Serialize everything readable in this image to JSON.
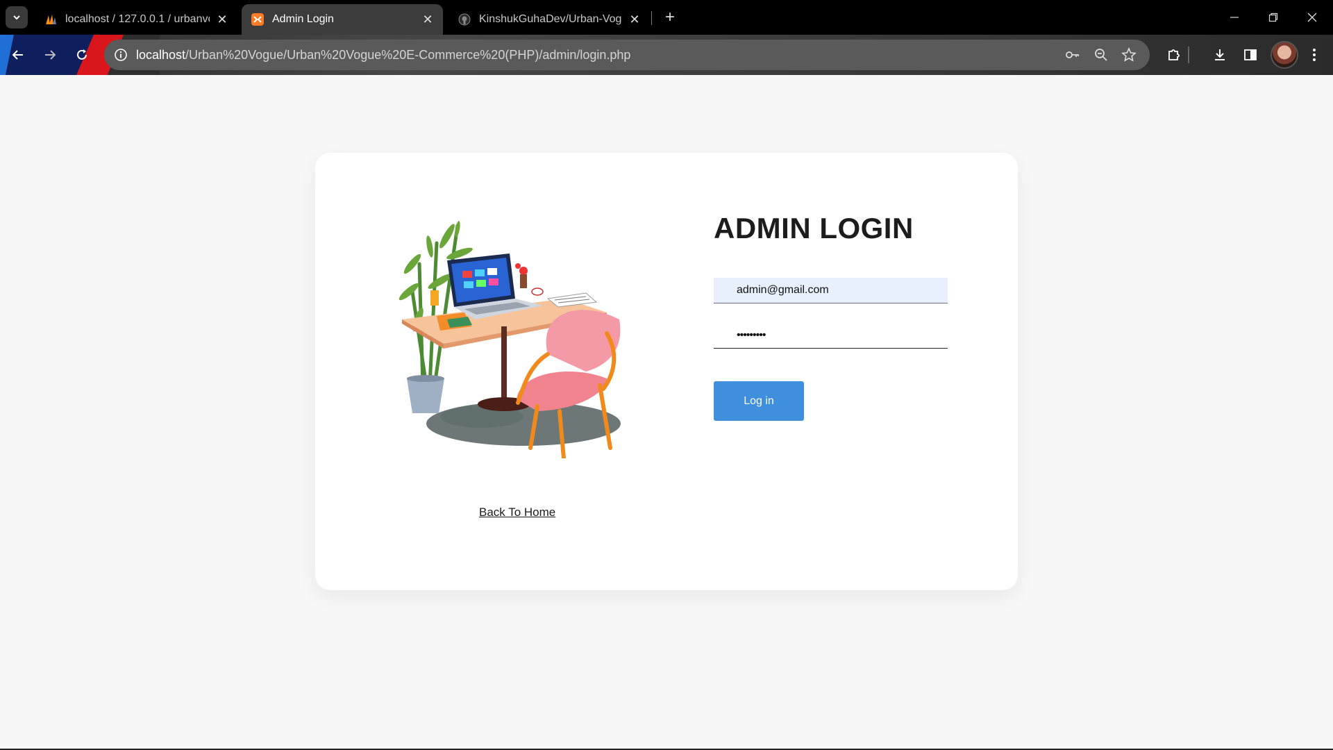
{
  "browser": {
    "tabs": [
      {
        "title": "localhost / 127.0.0.1 / urbanvogue",
        "active": false,
        "favicon": "phpmyadmin-icon"
      },
      {
        "title": "Admin Login",
        "active": true,
        "favicon": "xampp-icon"
      },
      {
        "title": "KinshukGuhaDev/Urban-Vogue",
        "active": false,
        "favicon": "github-icon"
      }
    ],
    "url_host": "localhost",
    "url_path": "/Urban%20Vogue/Urban%20Vogue%20E-Commerce%20(PHP)/admin/login.php"
  },
  "login": {
    "title": "ADMIN LOGIN",
    "email_value": "admin@gmail.com",
    "password_value": "•••••••••",
    "submit_label": "Log in",
    "back_link": "Back To Home"
  },
  "colors": {
    "button": "#3f8fdc",
    "autofill": "#e8f0fe",
    "page_bg": "#f7f7f7"
  }
}
